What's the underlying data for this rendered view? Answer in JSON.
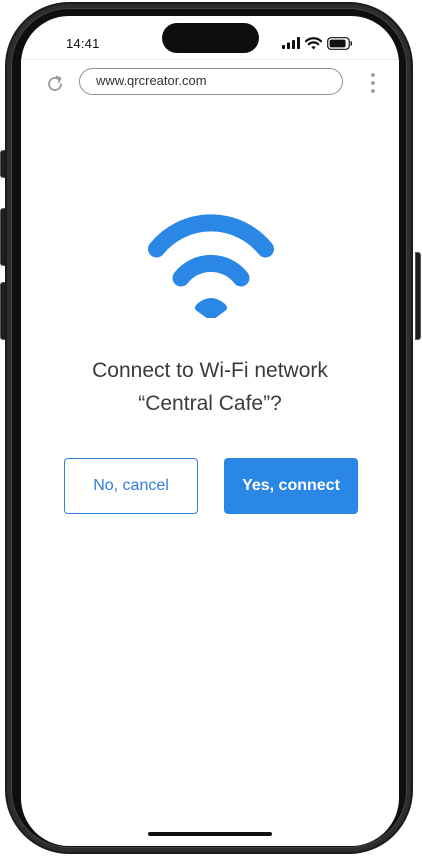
{
  "status_bar": {
    "time": "14:41",
    "icons": [
      "signal-icon",
      "wifi-icon",
      "battery-icon"
    ]
  },
  "browser": {
    "url": "www.qrcreator.com",
    "icons": [
      "reload-icon",
      "more-options-icon"
    ]
  },
  "dialog": {
    "icon": "wifi-icon",
    "prompt_line1": "Connect to Wi-Fi network",
    "prompt_line2": "“Central Cafe”?",
    "cancel_label": "No, cancel",
    "connect_label": "Yes, connect"
  },
  "colors": {
    "accent": "#2b87e6",
    "wifi_icon": "#2b87e6",
    "text": "#3b3b3b"
  }
}
